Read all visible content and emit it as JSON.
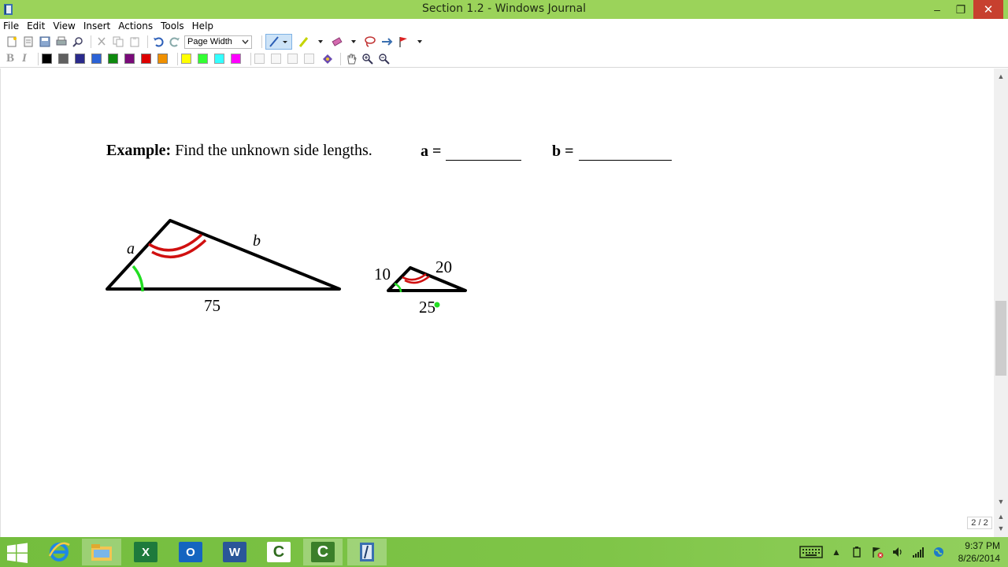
{
  "window": {
    "title": "Section 1.2 - Windows Journal",
    "minimize": "–",
    "maximize": "❐",
    "close": "✕"
  },
  "menu": [
    "File",
    "Edit",
    "View",
    "Insert",
    "Actions",
    "Tools",
    "Help"
  ],
  "toolbar": {
    "zoom_value": "Page Width",
    "bold": "B",
    "italic": "I",
    "pen_colors": [
      "#000000",
      "#606060",
      "#2a2a8c",
      "#2b62d6",
      "#0e8a0e",
      "#7a0a7a",
      "#dd0000",
      "#f09000"
    ],
    "highlighter_colors": [
      "#ffff00",
      "#33ff33",
      "#33ffff",
      "#ff00ff"
    ]
  },
  "document": {
    "example_bold": "Example:",
    "example_text": " Find the unknown side lengths.",
    "answer_a_label": "a =",
    "answer_b_label": "b =",
    "figure": {
      "big_side_a": "a",
      "big_side_b": "b",
      "big_base": "75",
      "small_left": "10",
      "small_right": "20",
      "small_base": "25"
    },
    "page_indicator": "2 / 2"
  },
  "taskbar": {
    "apps": [
      "internet-explorer",
      "file-explorer",
      "excel",
      "outlook",
      "word",
      "camtasia-recorder",
      "camtasia-studio",
      "windows-journal"
    ],
    "time": "9:37 PM",
    "date": "8/26/2014"
  }
}
